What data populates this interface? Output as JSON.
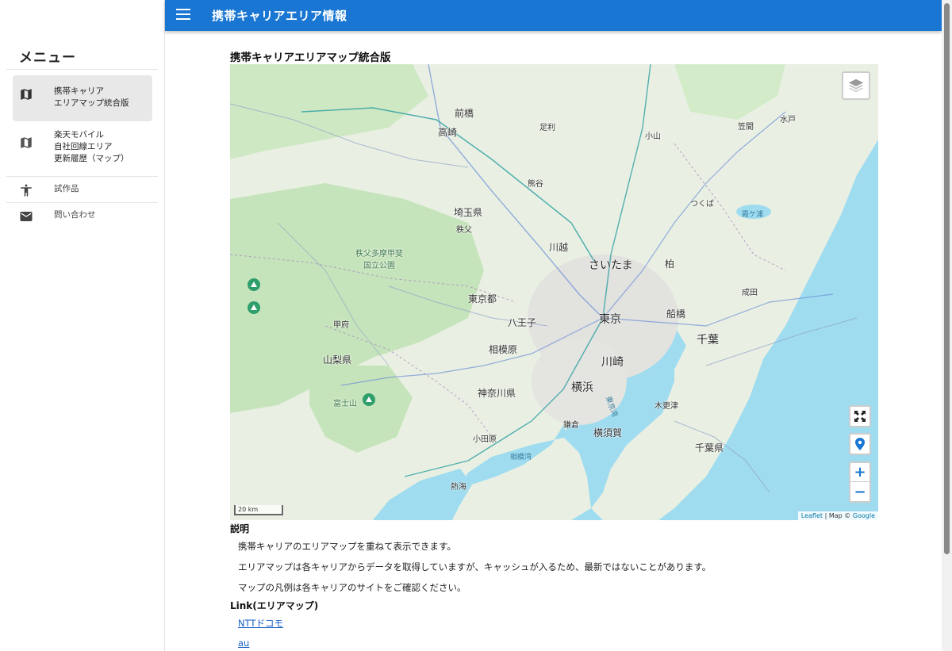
{
  "app": {
    "title": "携帯キャリアエリア情報"
  },
  "sidebar": {
    "title": "メニュー",
    "items": [
      {
        "label": "携帯キャリア\nエリアマップ統合版",
        "icon": "map-icon",
        "active": true
      },
      {
        "label": "楽天モバイル\n自社回線エリア\n更新履歴（マップ）",
        "icon": "map-icon",
        "active": false
      },
      {
        "label": "試作品",
        "icon": "accessibility-icon",
        "active": false
      },
      {
        "label": "問い合わせ",
        "icon": "mail-icon",
        "active": false
      }
    ]
  },
  "main": {
    "map_title": "携帯キャリアエリアマップ統合版",
    "map": {
      "scale_label": "20 km",
      "attribution_leaflet": "Leaflet",
      "attribution_sep": " | Map © ",
      "attribution_google": "Google",
      "labels": {
        "tokyo": "東京",
        "kawasaki": "川崎",
        "yokohama": "横浜",
        "chiba": "千葉",
        "saitama": "さいたま",
        "chiba_pref": "千葉県",
        "kanagawa_pref": "神奈川県",
        "tokyo_to": "東京都",
        "saitama_pref": "埼玉県",
        "yamanashi_pref": "山梨県",
        "chichibu_park": "秩父多摩甲斐\n国立公園",
        "maebashi": "前橋",
        "takasaki": "高崎",
        "hachioji": "八王子",
        "sagamihara": "相模原",
        "kawagoe": "川越",
        "funabashi": "船橋",
        "yokosuka": "横須賀",
        "fujisan": "富士山",
        "kofu": "甲府",
        "mito": "水戸",
        "tsukuba": "つくば",
        "kashiwa": "柏",
        "narita": "成田",
        "odawara": "小田原",
        "atami": "熱海",
        "sagami_bay": "相模湾",
        "tokyo_bay": "東京湾",
        "kisarazu": "木更津",
        "kamakura": "鎌倉",
        "chichibu": "秩父",
        "kumagaya": "熊谷",
        "ashikaga": "足利",
        "oyama": "小山",
        "kasama": "笠間",
        "kasumigaura": "霞ケ浦"
      }
    },
    "description_heading": "説明",
    "description": [
      "携帯キャリアのエリアマップを重ねて表示できます。",
      "エリアマップは各キャリアからデータを取得していますが、キャッシュが入るため、最新ではないことがあります。",
      "マップの凡例は各キャリアのサイトをご確認ください。"
    ],
    "links_heading": "Link(エリアマップ)",
    "links": [
      "NTTドコモ",
      "au"
    ]
  },
  "colors": {
    "app_bar": "#1976d2",
    "sea": "#9fdcf0",
    "land": "#e9f0e3",
    "forest": "#bfe0b5",
    "link": "#1a5fc4"
  }
}
